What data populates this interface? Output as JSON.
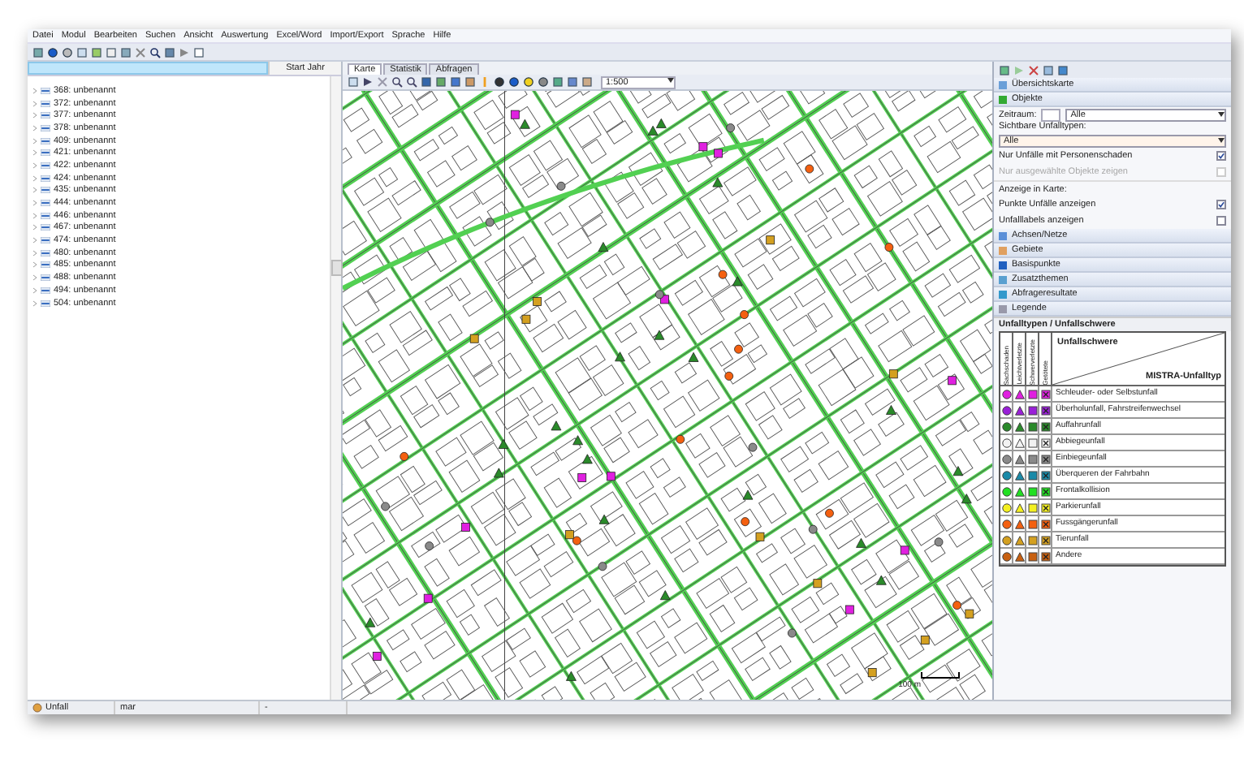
{
  "menu": [
    "Datei",
    "Modul",
    "Bearbeiten",
    "Suchen",
    "Ansicht",
    "Auswertung",
    "Excel/Word",
    "Import/Export",
    "Sprache",
    "Hilfe"
  ],
  "object_list": {
    "header": "Start Jahr",
    "items": [
      {
        "label": "368: unbenannt"
      },
      {
        "label": "372: unbenannt"
      },
      {
        "label": "377: unbenannt"
      },
      {
        "label": "378: unbenannt"
      },
      {
        "label": "409: unbenannt"
      },
      {
        "label": "421: unbenannt"
      },
      {
        "label": "422: unbenannt"
      },
      {
        "label": "424: unbenannt"
      },
      {
        "label": "435: unbenannt"
      },
      {
        "label": "444: unbenannt"
      },
      {
        "label": "446: unbenannt"
      },
      {
        "label": "467: unbenannt"
      },
      {
        "label": "474: unbenannt"
      },
      {
        "label": "480: unbenannt"
      },
      {
        "label": "485: unbenannt"
      },
      {
        "label": "488: unbenannt"
      },
      {
        "label": "494: unbenannt"
      },
      {
        "label": "504: unbenannt"
      }
    ]
  },
  "map_tabs": [
    {
      "label": "Karte",
      "selected": true
    },
    {
      "label": "Statistik",
      "selected": false
    },
    {
      "label": "Abfragen",
      "selected": false
    }
  ],
  "map": {
    "scale": "1:500",
    "scale_bar": "100 m"
  },
  "panel": {
    "sections_top": [
      {
        "label": "Übersichtskarte"
      },
      {
        "label": "Objekte"
      }
    ],
    "period_label": "Zeitraum:",
    "period_value": "Alle",
    "types_label": "Sichtbare Unfalltypen:",
    "types_value": "Alle",
    "options": [
      {
        "kind": "checkbox",
        "label": "Nur Unfälle mit Personenschaden",
        "checked": true,
        "disabled": false
      },
      {
        "kind": "checkbox",
        "label": "Nur ausgewählte Objekte zeigen",
        "checked": false,
        "disabled": true
      },
      {
        "kind": "heading",
        "label": "Anzeige in Karte:"
      },
      {
        "kind": "checkbox",
        "label": "Punkte Unfälle anzeigen",
        "checked": true,
        "disabled": false
      },
      {
        "kind": "checkbox",
        "label": "Unfalllabels anzeigen",
        "checked": false,
        "disabled": false
      }
    ],
    "sections": [
      {
        "label": "Achsen/Netze"
      },
      {
        "label": "Gebiete"
      },
      {
        "label": "Basispunkte"
      },
      {
        "label": "Zusatzthemen"
      },
      {
        "label": "Abfrageresultate"
      },
      {
        "label": "Legende"
      }
    ]
  },
  "legend": {
    "title": "Unfalltypen / Unfallschwere",
    "corner_top": "Unfallschwere",
    "corner_bottom": "MISTRA-Unfalltyp",
    "columns": [
      {
        "label": "Sachschaden",
        "kind": "circle"
      },
      {
        "label": "Leichtverletzte",
        "kind": "triangle"
      },
      {
        "label": "Schwerverletzte",
        "kind": "square"
      },
      {
        "label": "Getötete",
        "kind": "cross"
      }
    ],
    "rows": [
      {
        "label": "Schleuder- oder Selbstunfall",
        "color": "#e020e0"
      },
      {
        "label": "Überholunfall, Fahrstreifenwechsel",
        "color": "#9a20d8"
      },
      {
        "label": "Auffahrunfall",
        "color": "#2a8a2a"
      },
      {
        "label": "Abbiegeunfall",
        "color": "#f2f2f2"
      },
      {
        "label": "Einbiegeunfall",
        "color": "#8a8a8a"
      },
      {
        "label": "Überqueren der Fahrbahn",
        "color": "#1a8aa8"
      },
      {
        "label": "Frontalkollision",
        "color": "#22e022"
      },
      {
        "label": "Parkierunfall",
        "color": "#f4f020"
      },
      {
        "label": "Fussgängerunfall",
        "color": "#f46010"
      },
      {
        "label": "Tierunfall",
        "color": "#d4a020"
      },
      {
        "label": "Andere",
        "color": "#c86010"
      }
    ]
  },
  "status_bar": {
    "module": "Unfall",
    "field_2": "mar",
    "field_3": "-"
  }
}
